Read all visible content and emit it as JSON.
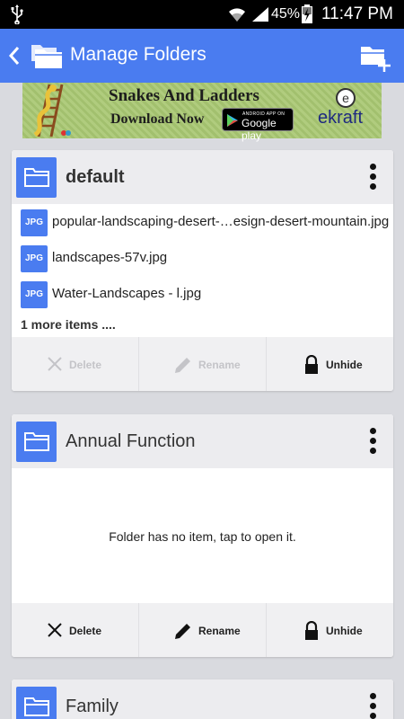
{
  "status_bar": {
    "battery_percent": "45%",
    "time": "11:47 PM",
    "icons": [
      "usb-icon",
      "wifi-icon",
      "signal-icon",
      "battery-charging-icon"
    ]
  },
  "app_bar": {
    "title": "Manage Folders",
    "accent_color": "#4a7cf0"
  },
  "ad": {
    "title": "Snakes And Ladders",
    "cta": "Download Now",
    "store_small": "ANDROID APP ON",
    "store_big": "Google play",
    "brand_letter": "e",
    "brand": "ekraft"
  },
  "folders": [
    {
      "name": "default",
      "files": [
        {
          "type": "JPG",
          "name": "popular-landscaping-desert-…esign-desert-mountain.jpg"
        },
        {
          "type": "JPG",
          "name": "landscapes-57v.jpg"
        },
        {
          "type": "JPG",
          "name": "Water-Landscapes - l.jpg"
        }
      ],
      "more": "1 more items ....",
      "actions": {
        "delete": "Delete",
        "rename": "Rename",
        "unhide": "Unhide"
      }
    },
    {
      "name": "Annual Function",
      "empty_message": "Folder has no item, tap to open it.",
      "actions": {
        "delete": "Delete",
        "rename": "Rename",
        "unhide": "Unhide"
      }
    },
    {
      "name": "Family"
    }
  ]
}
